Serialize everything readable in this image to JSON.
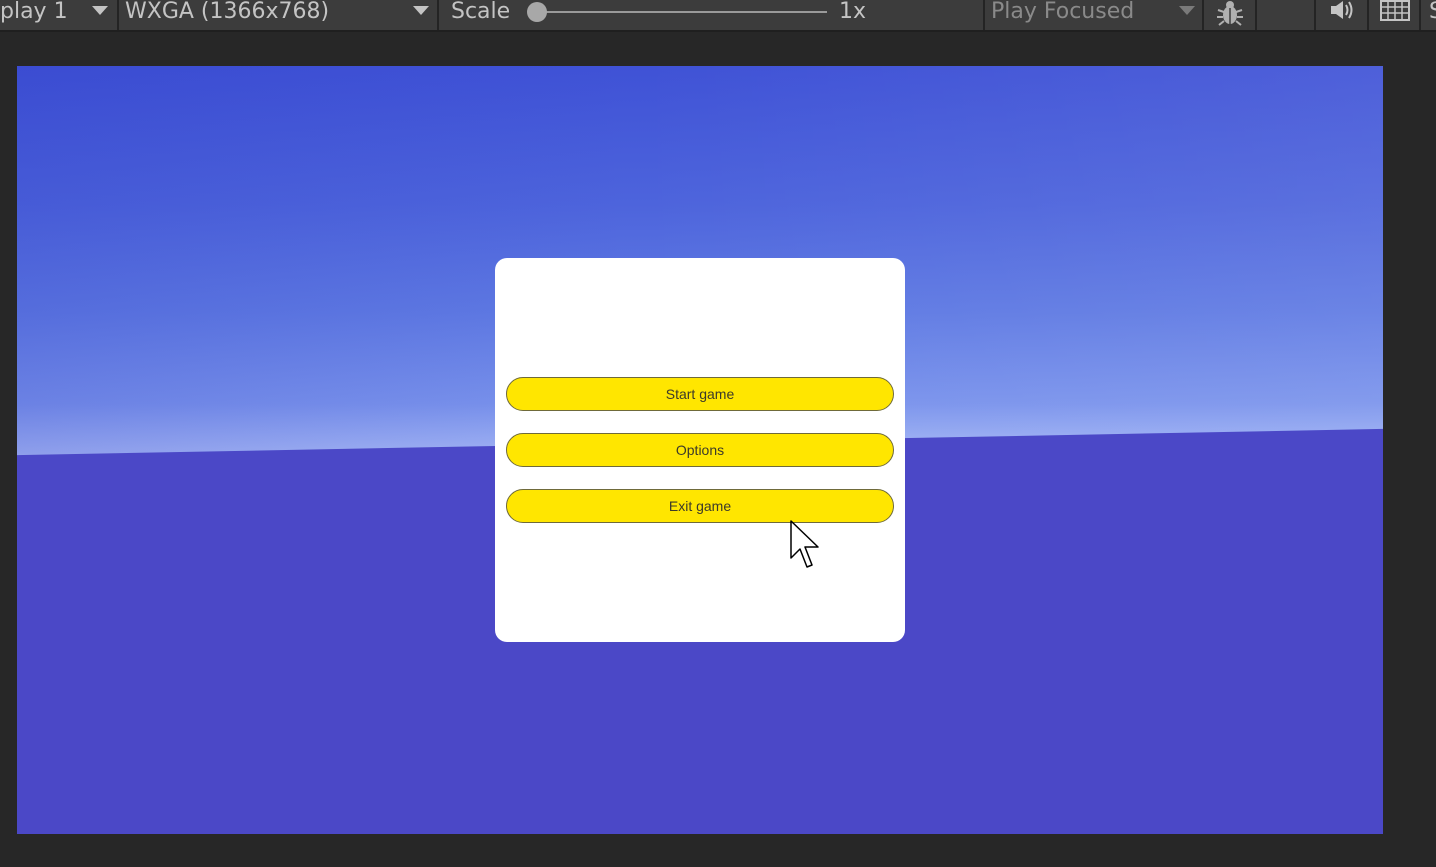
{
  "toolbar": {
    "display_label": "play 1",
    "resolution_label": "WXGA (1366x768)",
    "scale_label": "Scale",
    "scale_value": "1x",
    "scale_slider_fraction": 0,
    "play_mode_label": "Play Focused",
    "icons": [
      "bug-icon",
      "audio-mute-icon",
      "keyboard-icon"
    ]
  },
  "menu": {
    "buttons": [
      {
        "label": "Start game"
      },
      {
        "label": "Options"
      },
      {
        "label": "Exit game"
      }
    ]
  },
  "colors": {
    "editor_bg": "#272727",
    "toolbar_bg": "#3c3c3c",
    "sky_top": "#3f52d6",
    "horizon": "#c7d2fa",
    "ground": "#4b48c7",
    "panel_bg": "#ffffff",
    "button_bg": "#ffe600"
  }
}
